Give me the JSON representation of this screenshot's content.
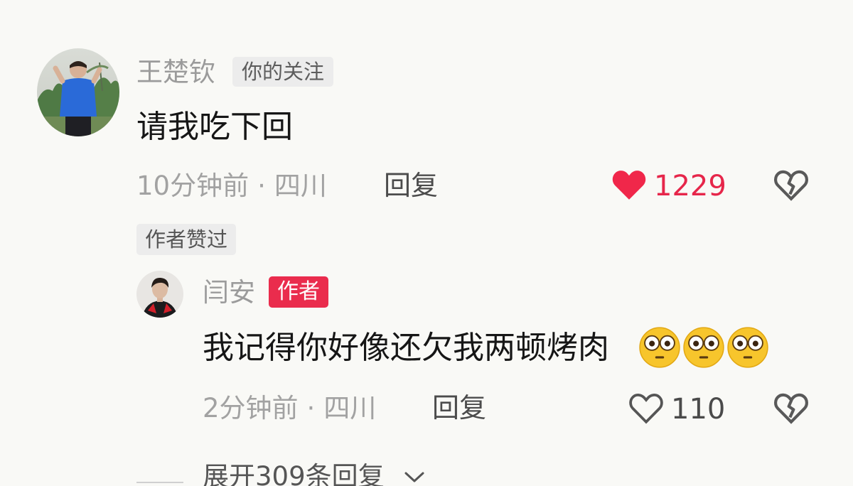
{
  "comment": {
    "username": "王楚钦",
    "follow_tag": "你的关注",
    "text": "请我吃下回",
    "time": "10分钟前",
    "location": "四川",
    "reply_label": "回复",
    "like_count": "1229",
    "liked": true,
    "liked_by_author_tag": "作者赞过"
  },
  "reply": {
    "username": "闫安",
    "author_tag": "作者",
    "text": "我记得你好像还欠我两顿烤肉",
    "emojis": [
      "flushed-face-emoji",
      "flushed-face-emoji",
      "flushed-face-emoji"
    ],
    "time": "2分钟前",
    "location": "四川",
    "reply_label": "回复",
    "like_count": "110",
    "liked": false
  },
  "expand": {
    "label": "展开309条回复"
  },
  "colors": {
    "like_red": "#f0274a",
    "author_red": "#ea2c4d",
    "meta_gray": "#a2a2a2",
    "text_dark": "#161616"
  },
  "icons": {
    "like_filled": "heart-filled-icon",
    "like_outline": "heart-outline-icon",
    "dislike": "broken-heart-icon",
    "expand": "chevron-down-icon"
  }
}
